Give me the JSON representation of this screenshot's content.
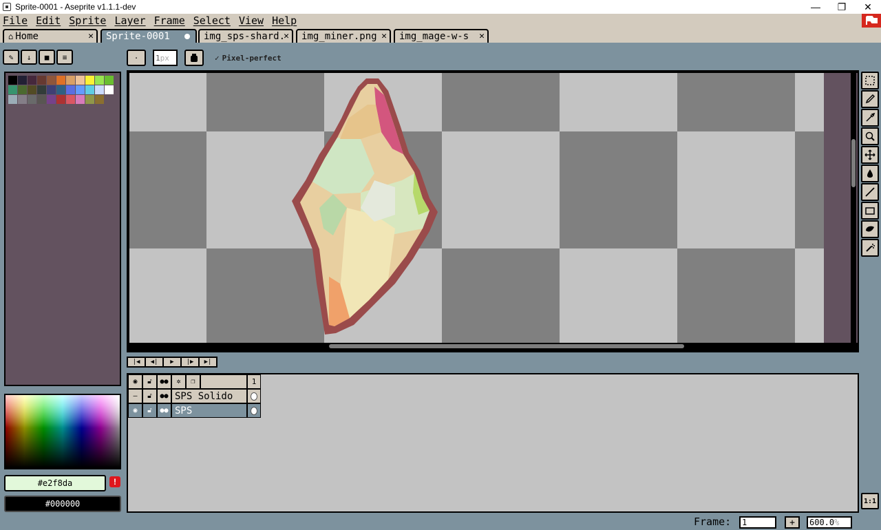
{
  "window": {
    "title": "Sprite-0001 - Aseprite v1.1.1-dev",
    "minimize": "—",
    "maximize": "❐",
    "close": "✕"
  },
  "menu": [
    "File",
    "Edit",
    "Sprite",
    "Layer",
    "Frame",
    "Select",
    "View",
    "Help"
  ],
  "tabs": [
    {
      "label": "Home",
      "icon": "home-icon",
      "close": "✕"
    },
    {
      "label": "Sprite-0001",
      "modified": true
    },
    {
      "label": "img_sps-shard.",
      "close": "✕"
    },
    {
      "label": "img_miner.png",
      "close": "✕"
    },
    {
      "label": "img_mage-w-s",
      "close": "✕"
    }
  ],
  "palette": {
    "swatches": [
      "#000000",
      "#222034",
      "#45283c",
      "#663931",
      "#8f563b",
      "#df7126",
      "#d9a066",
      "#eec39a",
      "#fbf236",
      "#99e550",
      "#6abe30",
      "#37946e",
      "#4b692f",
      "#524b24",
      "#323c39",
      "#3f3f74",
      "#306082",
      "#5b6ee1",
      "#639bff",
      "#5fcde4",
      "#cbdbfc",
      "#ffffff",
      "#9badb7",
      "#847e87",
      "#696a6a",
      "#595652",
      "#76428a",
      "#ac3232",
      "#d95763",
      "#d77bba",
      "#8f974a",
      "#8a6f30"
    ]
  },
  "colors": {
    "foreground": "#e2f8da",
    "background": "#000000",
    "fg_label": "#e2f8da",
    "bg_label": "#000000",
    "warning": "!"
  },
  "context_bar": {
    "brush_size": "1",
    "brush_unit": "px",
    "pixel_perfect": "Pixel-perfect",
    "pixel_perfect_checked": true
  },
  "tools": [
    "rectangular-marquee-icon",
    "pencil-icon",
    "eyedropper-icon",
    "zoom-icon",
    "move-icon",
    "paint-bucket-icon",
    "line-icon",
    "rectangle-icon",
    "contour-icon",
    "spray-icon"
  ],
  "timeline": {
    "header_frame": "1",
    "layers": [
      {
        "name": "SPS Solido",
        "visible": false,
        "active": false
      },
      {
        "name": "SPS",
        "visible": true,
        "active": true
      }
    ]
  },
  "statusbar": {
    "frame_label": "Frame:",
    "frame_value": "1",
    "add": "+",
    "zoom_value": "600.0",
    "zoom_unit": "%"
  },
  "zoom_button": "1:1"
}
